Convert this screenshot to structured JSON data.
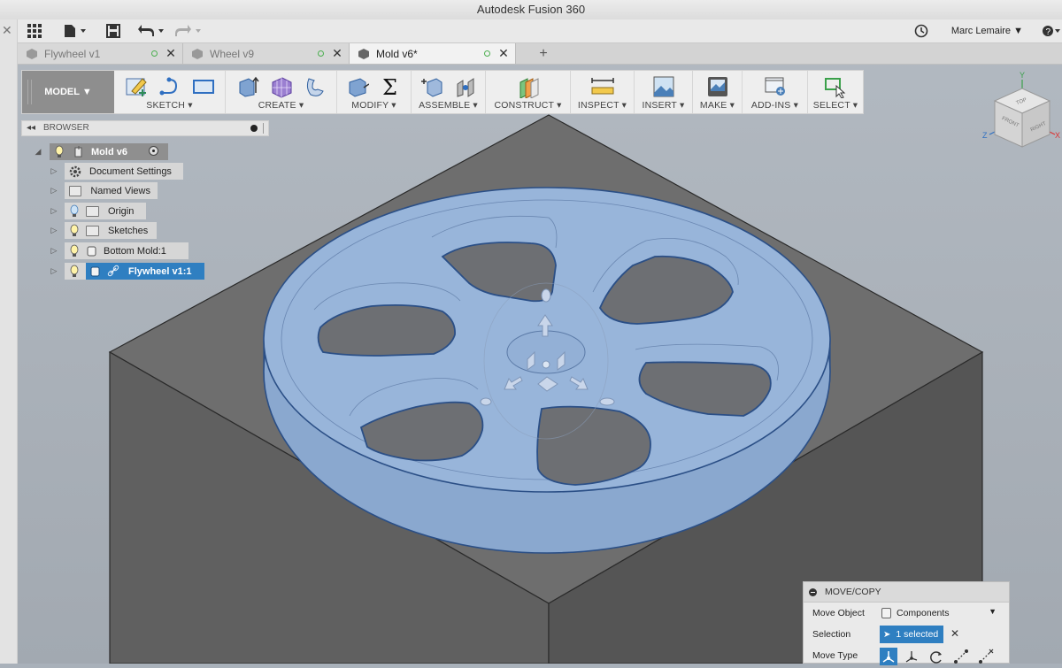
{
  "window": {
    "title": "Autodesk Fusion 360"
  },
  "appbar": {
    "user": "Marc Lemaire ▼"
  },
  "tabs": [
    {
      "label": "Flywheel v1",
      "active": false
    },
    {
      "label": "Wheel v9",
      "active": false
    },
    {
      "label": "Mold v6*",
      "active": true
    }
  ],
  "toolbar": {
    "workspace": "MODEL ▼",
    "groups": [
      {
        "label": "SKETCH ▾"
      },
      {
        "label": "CREATE ▾"
      },
      {
        "label": "MODIFY ▾"
      },
      {
        "label": "ASSEMBLE ▾"
      },
      {
        "label": "CONSTRUCT ▾"
      },
      {
        "label": "INSPECT ▾"
      },
      {
        "label": "INSERT ▾"
      },
      {
        "label": "MAKE ▾"
      },
      {
        "label": "ADD-INS ▾"
      },
      {
        "label": "SELECT ▾"
      }
    ]
  },
  "browser": {
    "title": "BROWSER",
    "root": "Mold v6",
    "items": [
      {
        "label": "Document Settings",
        "icon": "gear-icon"
      },
      {
        "label": "Named Views",
        "icon": "folder-icon"
      },
      {
        "label": "Origin",
        "icon": "folder-icon"
      },
      {
        "label": "Sketches",
        "icon": "folder-icon"
      },
      {
        "label": "Bottom Mold:1",
        "icon": "body-icon"
      },
      {
        "label": "Flywheel v1:1",
        "icon": "link-icon",
        "selected": true
      }
    ]
  },
  "viewcube": {
    "top": "TOP",
    "front": "FRONT",
    "right": "RIGHT",
    "axis_y": "Y",
    "axis_z": "Z",
    "axis_x": "X"
  },
  "move_copy": {
    "title": "MOVE/COPY",
    "move_object_label": "Move Object",
    "move_object_value": "Components",
    "selection_label": "Selection",
    "selection_value": "1 selected",
    "move_type_label": "Move Type"
  },
  "colors": {
    "selection": "#2f7fc1",
    "part_fill": "#97b3d8",
    "mold_top": "#6d6d6d",
    "mold_side": "#5a5a5a",
    "background": "#a9b1ba"
  }
}
